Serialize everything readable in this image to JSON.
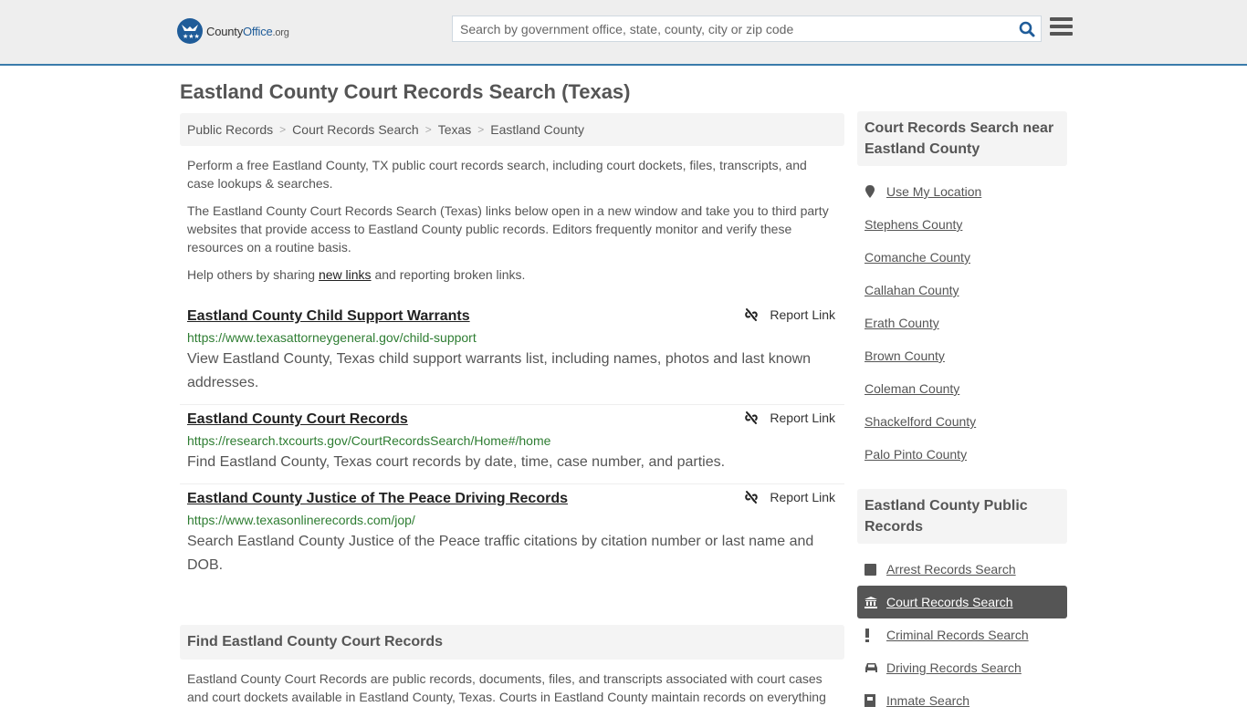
{
  "header": {
    "logo": {
      "name": "County",
      "brand": "Office",
      "tld": ".org"
    },
    "search_placeholder": "Search by government office, state, county, city or zip code",
    "search_value": ""
  },
  "page": {
    "title": "Eastland County Court Records Search (Texas)"
  },
  "breadcrumb": [
    "Public Records",
    "Court Records Search",
    "Texas",
    "Eastland County"
  ],
  "intro": {
    "p1": "Perform a free Eastland County, TX public court records search, including court dockets, files, transcripts, and case lookups & searches.",
    "p2": "The Eastland County Court Records Search (Texas) links below open in a new window and take you to third party websites that provide access to Eastland County public records. Editors frequently monitor and verify these resources on a routine basis.",
    "p3_before": "Help others by sharing ",
    "p3_link": "new links",
    "p3_after": " and reporting broken links."
  },
  "links": [
    {
      "title": "Eastland County Child Support Warrants",
      "url": "https://www.texasattorneygeneral.gov/child-support",
      "description": "View Eastland County, Texas child support warrants list, including names, photos and last known addresses.",
      "report_label": "Report Link"
    },
    {
      "title": "Eastland County Court Records",
      "url": "https://research.txcourts.gov/CourtRecordsSearch/Home#/home",
      "description": "Find Eastland County, Texas court records by date, time, case number, and parties.",
      "report_label": "Report Link"
    },
    {
      "title": "Eastland County Justice of The Peace Driving Records",
      "url": "https://www.texasonlinerecords.com/jop/",
      "description": "Search Eastland County Justice of the Peace traffic citations by citation number or last name and DOB.",
      "report_label": "Report Link"
    }
  ],
  "find_section": {
    "heading": "Find Eastland County Court Records",
    "body": "Eastland County Court Records are public records, documents, files, and transcripts associated with court cases and court dockets available in Eastland County, Texas. Courts in Eastland County maintain records on everything"
  },
  "sidebar": {
    "nearby_heading": "Court Records Search near Eastland County",
    "use_location": "Use My Location",
    "nearby": [
      "Stephens County",
      "Comanche County",
      "Callahan County",
      "Erath County",
      "Brown County",
      "Coleman County",
      "Shackelford County",
      "Palo Pinto County"
    ],
    "public_heading": "Eastland County Public Records",
    "public_items": [
      {
        "label": "Arrest Records Search",
        "icon": "square-icon",
        "active": false
      },
      {
        "label": "Court Records Search",
        "icon": "courthouse-icon",
        "active": true
      },
      {
        "label": "Criminal Records Search",
        "icon": "exclamation-icon",
        "active": false
      },
      {
        "label": "Driving Records Search",
        "icon": "car-icon",
        "active": false
      },
      {
        "label": "Inmate Search",
        "icon": "inmate-icon",
        "active": false
      }
    ]
  }
}
